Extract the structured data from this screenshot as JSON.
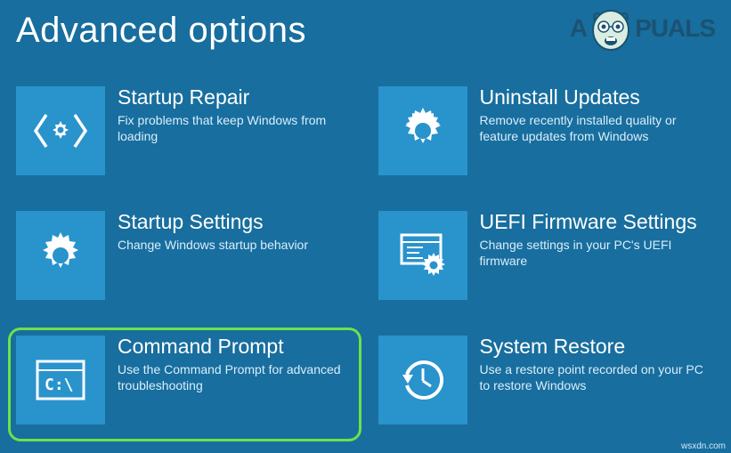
{
  "page": {
    "title": "Advanced options"
  },
  "watermark": {
    "prefix": "A",
    "suffix": "PUALS",
    "credit": "wsxdn.com"
  },
  "tiles": {
    "startup_repair": {
      "title": "Startup Repair",
      "desc": "Fix problems that keep Windows from loading"
    },
    "uninstall_updates": {
      "title": "Uninstall Updates",
      "desc": "Remove recently installed quality or feature updates from Windows"
    },
    "startup_settings": {
      "title": "Startup Settings",
      "desc": "Change Windows startup behavior"
    },
    "uefi": {
      "title": "UEFI Firmware Settings",
      "desc": "Change settings in your PC's UEFI firmware"
    },
    "command_prompt": {
      "title": "Command Prompt",
      "desc": "Use the Command Prompt for advanced troubleshooting"
    },
    "system_restore": {
      "title": "System Restore",
      "desc": "Use a restore point recorded on your PC to restore Windows"
    }
  }
}
